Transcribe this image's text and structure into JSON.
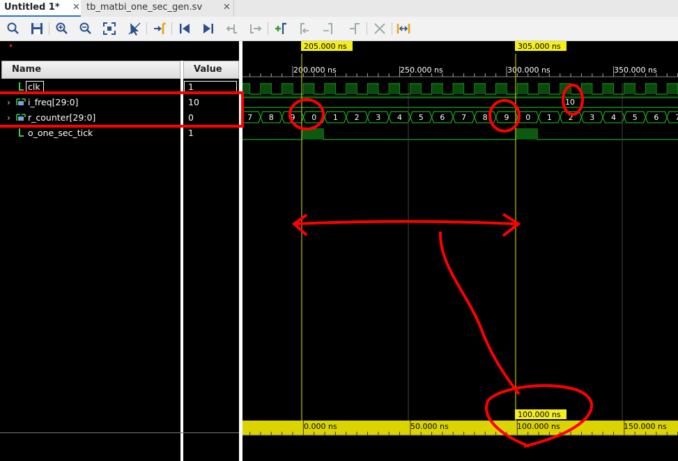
{
  "tabs": [
    {
      "label": "Untitled 1*",
      "close": "✕",
      "active": true
    },
    {
      "label": "tb_matbi_one_sec_gen.sv",
      "close": "✕",
      "active": false
    }
  ],
  "toolbar": {
    "icons": [
      "search-icon",
      "save-icon",
      "zoom-in-icon",
      "zoom-out-icon",
      "zoom-fit-icon",
      "cursor-icon",
      "goto-cursor-icon",
      "goto-start-icon",
      "goto-end-icon",
      "previous-transition-icon",
      "next-transition-icon",
      "add-marker-icon",
      "previous-marker-icon",
      "next-marker-icon",
      "swap-cursors-icon",
      "cut-icon",
      "snap-to-transition-icon"
    ]
  },
  "columns": {
    "name": "Name",
    "value": "Value"
  },
  "signals": [
    {
      "name": "clk",
      "value": "1",
      "expandable": false,
      "kind": "bit"
    },
    {
      "name": "i_freq[29:0]",
      "value": "10",
      "expandable": true,
      "kind": "bus"
    },
    {
      "name": "r_counter[29:0]",
      "value": "0",
      "expandable": true,
      "kind": "bus"
    },
    {
      "name": "o_one_sec_tick",
      "value": "1",
      "expandable": false,
      "kind": "bit"
    }
  ],
  "cursors": {
    "primary_label": "205.000 ns",
    "secondary_label": "305.000 ns",
    "delta_label": "100.000 ns"
  },
  "timeline": {
    "top_ticks": [
      "200.000 ns",
      "250.000 ns",
      "300.000 ns",
      "350.000 ns"
    ],
    "bottom_ticks": [
      "0.000 ns",
      "50.000 ns",
      "100.000 ns",
      "150.000 ns"
    ]
  },
  "waveforms": {
    "i_freq_value": "10",
    "r_counter_sequence": [
      "7",
      "8",
      "9",
      "0",
      "1",
      "2",
      "3",
      "4",
      "5",
      "6",
      "7",
      "8",
      "9",
      "0",
      "1",
      "2",
      "3",
      "4",
      "5",
      "6",
      "7"
    ]
  },
  "colors": {
    "wave": "#22cc22",
    "cursor": "#e8e80a",
    "annotation": "#ff0000",
    "background": "#000000"
  }
}
